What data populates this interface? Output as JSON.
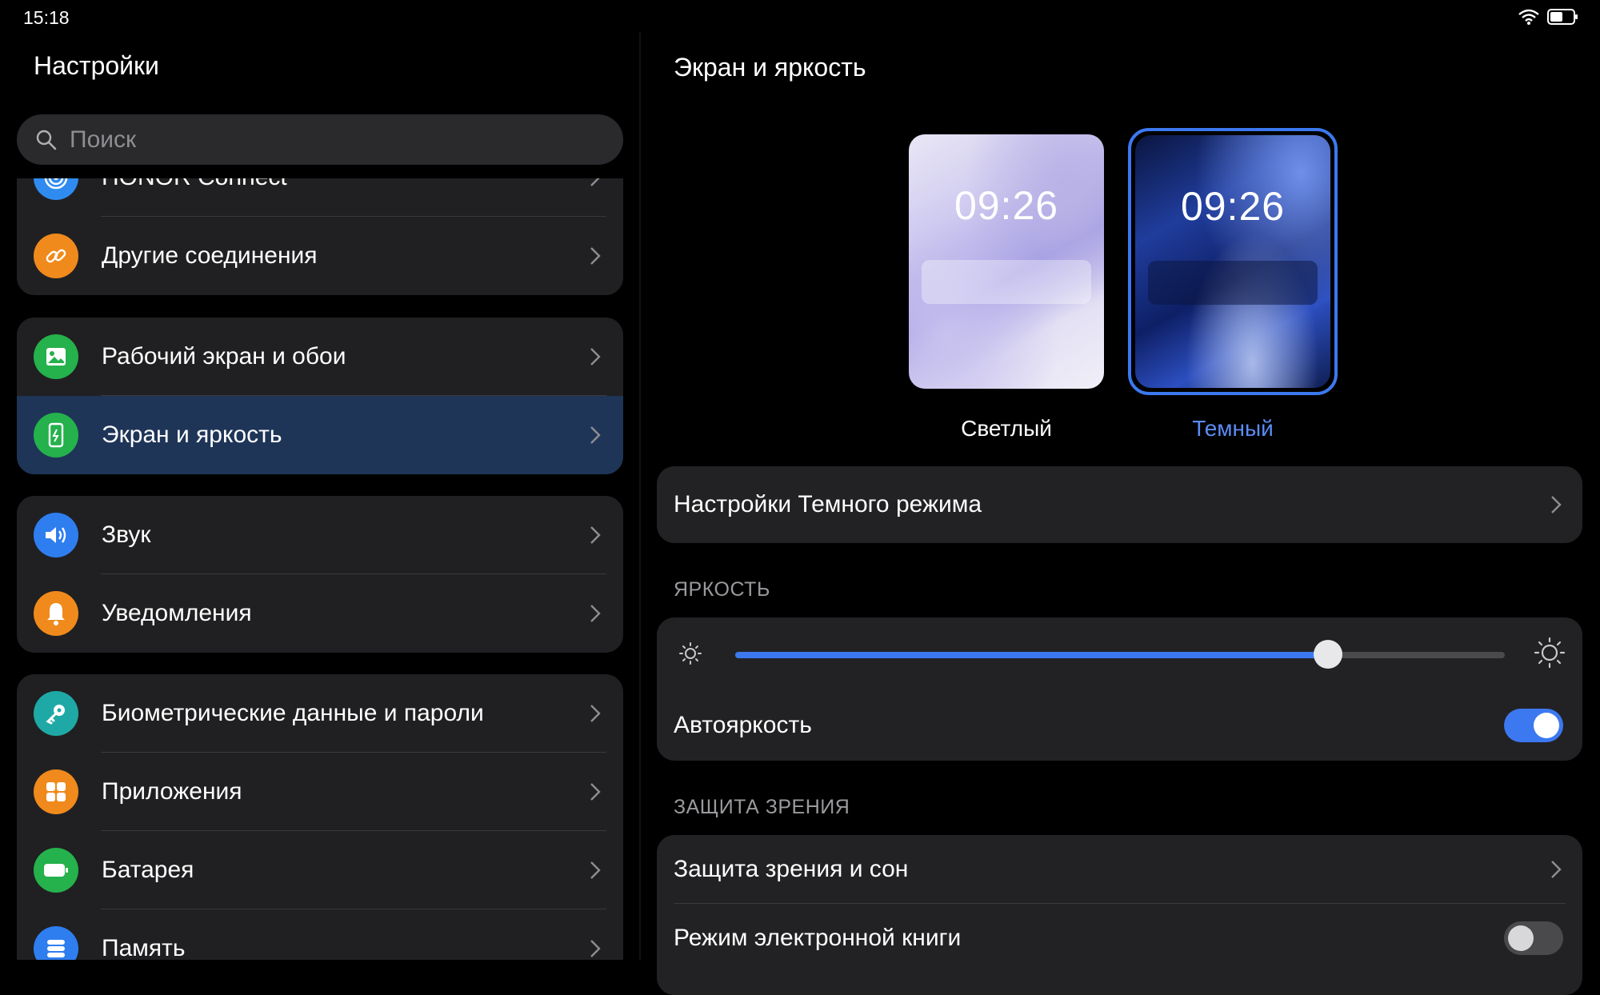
{
  "status_bar": {
    "time": "15:18",
    "wifi_icon": "wifi-icon",
    "battery_icon": "battery-icon"
  },
  "left": {
    "title": "Настройки",
    "search_placeholder": "Поиск",
    "groups": [
      {
        "items": [
          {
            "label": "HONOR Connect",
            "icon": "honor-connect-icon",
            "color": "#2f8bf0"
          },
          {
            "label": "Другие соединения",
            "icon": "link-icon",
            "color": "#f08a1c"
          }
        ]
      },
      {
        "items": [
          {
            "label": "Рабочий экран и обои",
            "icon": "image-icon",
            "color": "#25b14c"
          },
          {
            "label": "Экран и яркость",
            "icon": "display-icon",
            "color": "#25b14c",
            "active": true
          }
        ]
      },
      {
        "items": [
          {
            "label": "Звук",
            "icon": "speaker-icon",
            "color": "#2f7ef0"
          },
          {
            "label": "Уведомления",
            "icon": "bell-icon",
            "color": "#f08a1c"
          }
        ]
      },
      {
        "items": [
          {
            "label": "Биометрические данные и пароли",
            "icon": "key-icon",
            "color": "#1fa9a6"
          },
          {
            "label": "Приложения",
            "icon": "apps-icon",
            "color": "#f08a1c"
          },
          {
            "label": "Батарея",
            "icon": "battery-icon",
            "color": "#25b14c"
          },
          {
            "label": "Память",
            "icon": "storage-icon",
            "color": "#2f7ef0"
          }
        ]
      }
    ]
  },
  "right": {
    "title": "Экран и яркость",
    "theme_light": {
      "time": "09:26",
      "label": "Светлый"
    },
    "theme_dark": {
      "time": "09:26",
      "label": "Темный",
      "selected": true
    },
    "dark_mode_settings": "Настройки Темного режима",
    "brightness_header": "ЯРКОСТЬ",
    "brightness_level": 0.77,
    "auto_brightness": {
      "label": "Автояркость",
      "on": true
    },
    "eye_header": "ЗАЩИТА ЗРЕНИЯ",
    "eye_comfort": "Защита зрения и сон",
    "ebook_mode": {
      "label": "Режим электронной книги",
      "on": false
    }
  },
  "colors": {
    "accent": "#3c78f0",
    "active_row": "#1e3558"
  }
}
